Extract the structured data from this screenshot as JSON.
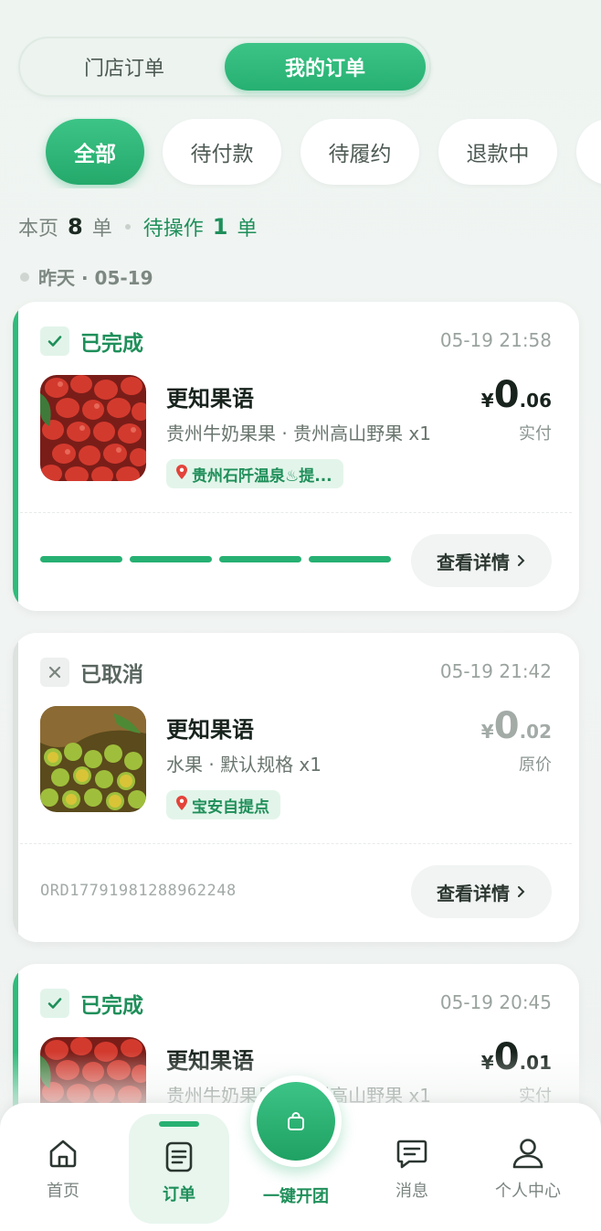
{
  "segment": {
    "store_orders": "门店订单",
    "my_orders": "我的订单"
  },
  "filters": [
    "全部",
    "待付款",
    "待履约",
    "退款中"
  ],
  "summary": {
    "prefix": "本页",
    "count": "8",
    "unit": "单",
    "pending_label": "待操作",
    "pending_count": "1",
    "pending_unit": "单"
  },
  "date_group": "昨天 · 05-19",
  "orders": [
    {
      "status": "已完成",
      "time": "05-19 21:58",
      "store": "更知果语",
      "goods": "贵州牛奶果果 · 贵州高山野果 x1",
      "location": "贵州石阡温泉♨提...",
      "price_cur": "¥",
      "price_int": "0",
      "price_dec": ".06",
      "price_label": "实付",
      "detail_btn": "查看详情",
      "progress_steps": 4
    },
    {
      "status": "已取消",
      "time": "05-19 21:42",
      "store": "更知果语",
      "goods": "水果 · 默认规格 x1",
      "location": "宝安自提点",
      "price_cur": "¥",
      "price_int": "0",
      "price_dec": ".02",
      "price_label": "原价",
      "detail_btn": "查看详情",
      "order_no": "ORD17791981288962248"
    },
    {
      "status": "已完成",
      "time": "05-19 20:45",
      "store": "更知果语",
      "goods": "贵州牛奶果果 · 贵州高山野果 x1",
      "price_cur": "¥",
      "price_int": "0",
      "price_dec": ".01",
      "price_label": "实付"
    }
  ],
  "tabbar": {
    "home": "首页",
    "orders": "订单",
    "group": "一键开团",
    "messages": "消息",
    "profile": "个人中心"
  },
  "colors": {
    "accent": "#26b072",
    "accent_dark": "#1f8f5a",
    "location_bg": "#e3f5ea"
  }
}
